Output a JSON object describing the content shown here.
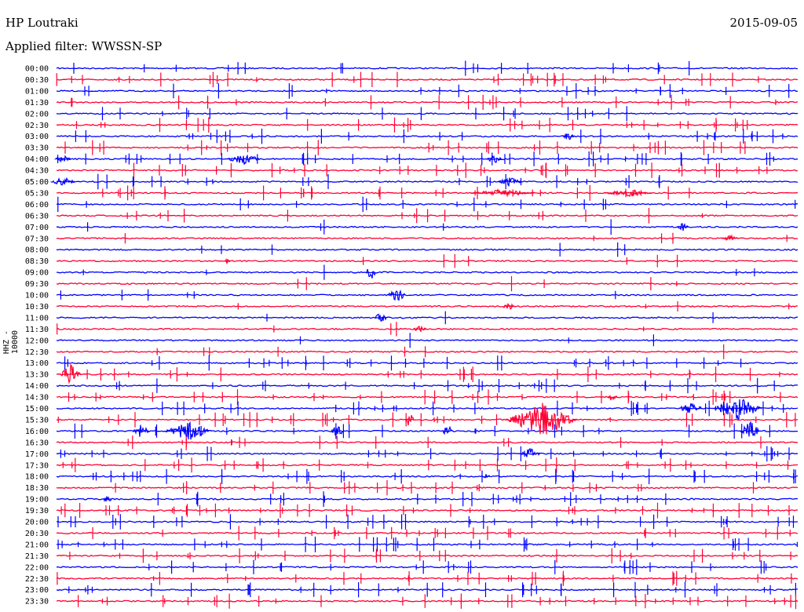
{
  "header": {
    "station": "HP Loutraki",
    "filter": "Applied filter: WWSSN-SP",
    "date": "2015-09-05",
    "channel": "HHZ - 10000"
  },
  "colors": {
    "even_rows": "#0000ff",
    "odd_rows": "#ff0033",
    "labels": "#000000"
  },
  "chart_data": {
    "type": "line",
    "title": "",
    "xlabel": "",
    "ylabel": "HHZ - 10000",
    "grid": false,
    "legend": "none",
    "row_labels": [
      "00:00",
      "00:30",
      "01:00",
      "01:30",
      "02:00",
      "02:30",
      "03:00",
      "03:30",
      "04:00",
      "04:30",
      "05:00",
      "05:30",
      "06:00",
      "06:30",
      "07:00",
      "07:30",
      "08:00",
      "08:30",
      "09:00",
      "09:30",
      "10:00",
      "10:30",
      "11:00",
      "11:30",
      "12:00",
      "12:30",
      "13:00",
      "13:30",
      "14:00",
      "14:30",
      "15:00",
      "15:30",
      "16:00",
      "16:30",
      "17:00",
      "17:30",
      "18:00",
      "18:30",
      "19:00",
      "19:30",
      "20:00",
      "20:30",
      "21:00",
      "21:30",
      "22:00",
      "22:30",
      "23:00",
      "23:30"
    ]
  }
}
